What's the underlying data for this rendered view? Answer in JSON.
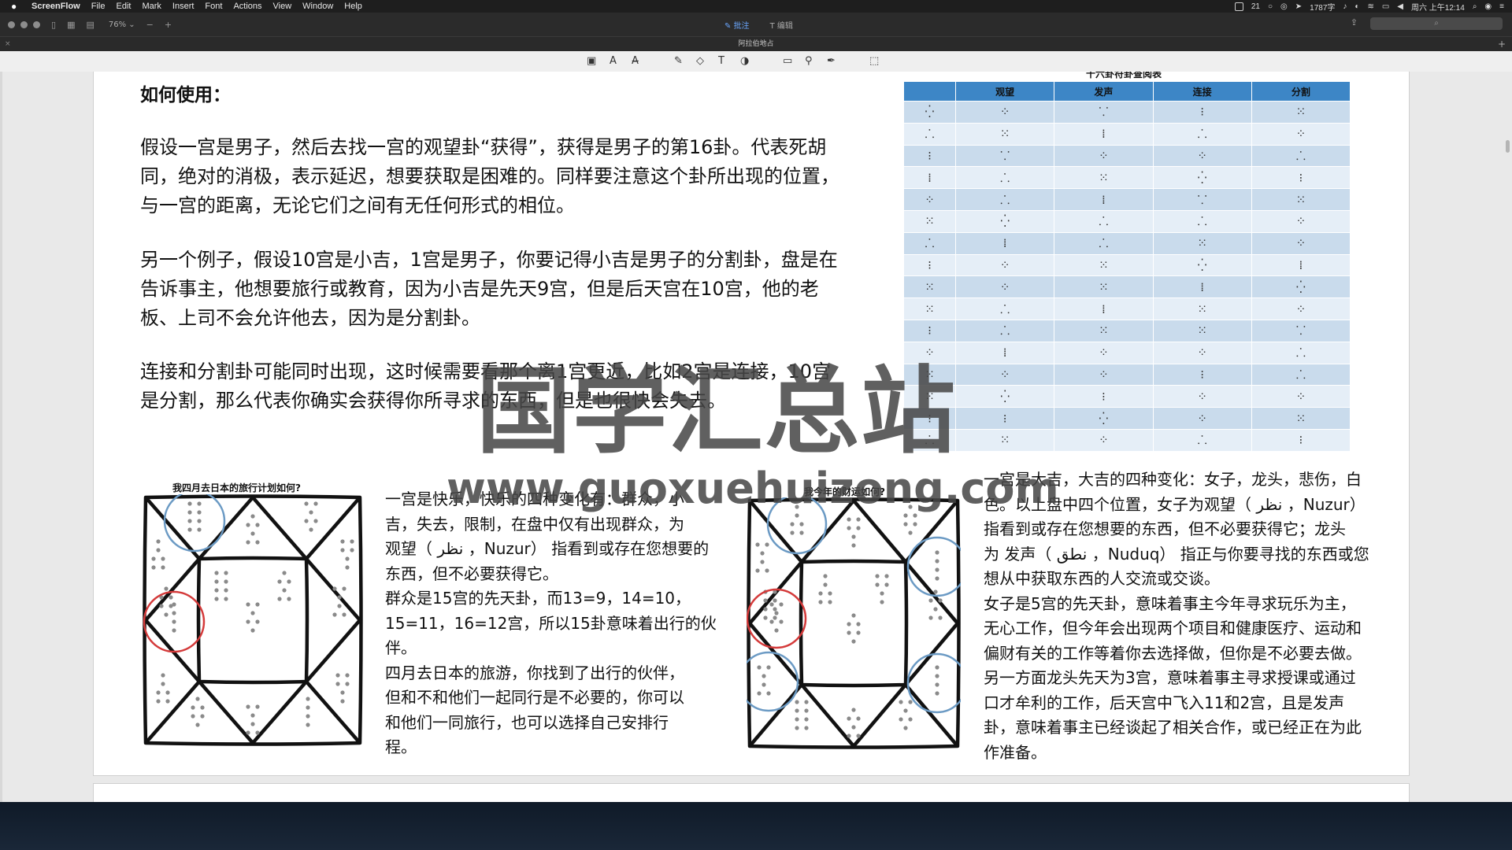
{
  "menubar": {
    "app_name": "ScreenFlow",
    "menus": [
      "File",
      "Edit",
      "Mark",
      "Insert",
      "Font",
      "Actions",
      "View",
      "Window",
      "Help"
    ],
    "status_items": [
      "21",
      "1787字",
      "周六 上午12:14"
    ]
  },
  "window": {
    "zoom": "76%",
    "mode_annotate": "批注",
    "mode_edit": "编辑",
    "document_title": "阿拉伯地占"
  },
  "doc": {
    "heading": "如何使用：",
    "para1": "假设一宫是男子，然后去找一宫的观望卦“获得”，获得是男子的第16卦。代表死胡同，绝对的消极，表示延迟，想要获取是困难的。同样要注意这个卦所出现的位置，与一宫的距离，无论它们之间有无任何形式的相位。",
    "para2": "另一个例子，假设10宫是小吉，1宫是男子，你要记得小吉是男子的分割卦，盘是在告诉事主，他想要旅行或教育，因为小吉是先天9宫，但是后天宫在10宫，他的老板、上司不会允许他去，因为是分割卦。",
    "para3": "连接和分割卦可能同时出现，这时候需要看那个离1宫更近，比如2宫是连接，10宫是分割，那么代表你确实会获得你所寻求的东西，但是也很快会失去。",
    "table_title": "十六卦符卦查阅表",
    "table_headers": [
      "",
      "观望",
      "发声",
      "连接",
      "分割"
    ],
    "table_rows": [
      [
        "⁛",
        "⁘",
        "⸪",
        "⁝",
        "⁙"
      ],
      [
        "⸫",
        "⁙",
        "⁞",
        "⸫",
        "⁘"
      ],
      [
        "⁝",
        "⸪",
        "⁘",
        "⁘",
        "⸫"
      ],
      [
        "⁞",
        "⸫",
        "⁙",
        "⁛",
        "⁝"
      ],
      [
        "⁘",
        "⸫",
        "⁞",
        "⸪",
        "⁙"
      ],
      [
        "⁙",
        "⁛",
        "⸫",
        "⸫",
        "⁘"
      ],
      [
        "⸫",
        "⁞",
        "⸫",
        "⁙",
        "⁘"
      ],
      [
        "⁝",
        "⁘",
        "⁙",
        "⁛",
        "⁞"
      ],
      [
        "⁙",
        "⁘",
        "⁙",
        "⁞",
        "⁛"
      ],
      [
        "⁙",
        "⸫",
        "⁞",
        "⁙",
        "⁘"
      ],
      [
        "⁝",
        "⸫",
        "⁙",
        "⁙",
        "⸪"
      ],
      [
        "⁘",
        "⁞",
        "⁘",
        "⁘",
        "⸫"
      ],
      [
        "⁙",
        "⁘",
        "⁘",
        "⁝",
        "⸫"
      ],
      [
        "⁙",
        "⁛",
        "⁝",
        "⁘",
        "⁘"
      ],
      [
        "⁝",
        "⁝",
        "⁛",
        "⁘",
        "⁙"
      ],
      [
        "⸫",
        "⁙",
        "⁘",
        "⸫",
        "⁝"
      ]
    ],
    "fig1_title": "我四月去日本的旅行计划如何?",
    "fig1_text": [
      "一宫是快乐，快乐的四种变化有：群众，小",
      "吉，失去，限制，在盘中仅有出现群众，为",
      "观望（ نظر ，Nuzur） 指看到或存在您想要的",
      "东西，但不必要获得它。",
      "群众是15宫的先天卦，而13=9，14=10，",
      "15=11，16=12宫，所以15卦意味着出行的伙",
      "伴。",
      "四月去日本的旅游，你找到了出行的伙伴，",
      "但和不和他们一起同行是不必要的，你可以",
      "和他们一同旅行，也可以选择自己安排行",
      "程。"
    ],
    "fig2_title": "我今年的财运如何?",
    "fig2_text": [
      "一宫是大吉，大吉的四种变化：女子，龙头，悲伤，白",
      "色。以上盘中四个位置，女子为观望（ نظر ，Nuzur）",
      "指看到或存在您想要的东西，但不必要获得它；龙头",
      "为 发声（ نطق ，Nuduq） 指正与你要寻找的东西或您",
      "想从中获取东西的人交流或交谈。",
      "女子是5宫的先天卦，意味着事主今年寻求玩乐为主，",
      "无心工作，但今年会出现两个项目和健康医疗、运动和",
      "偏财有关的工作等着你去选择做，但你是不必要去做。",
      "另一方面龙头先天为3宫，意味着事主寻求授课或通过",
      "口才牟利的工作，后天宫中飞入11和2宫，且是发声",
      "卦，意味着事主已经谈起了相关合作，或已经正在为此",
      "作准备。"
    ]
  },
  "watermark": {
    "cn": "国学汇总站",
    "url": "www.guoxuehuizong.com"
  },
  "colors": {
    "table_header": "#3d86c6",
    "circle_blue": "#6b9ac4",
    "circle_red": "#d43a3a"
  }
}
